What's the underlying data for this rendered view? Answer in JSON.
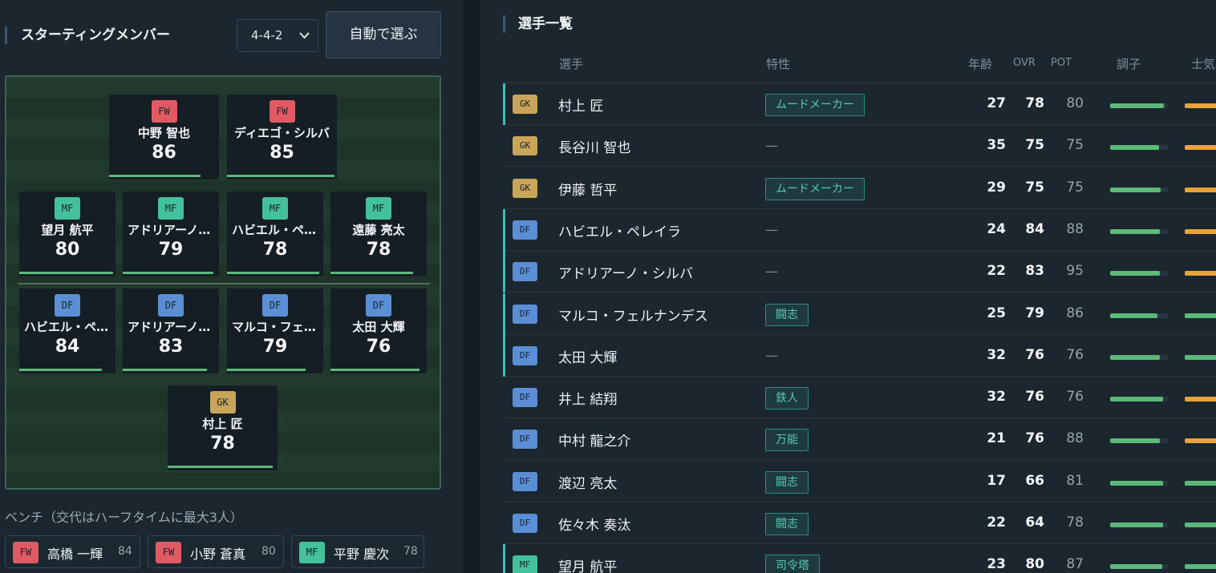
{
  "starting": {
    "title": "スターティングメンバー",
    "formation": "4-4-2",
    "auto_button": "自動で選ぶ"
  },
  "pitch_players": [
    {
      "pos": "FW",
      "name": "中野 智也",
      "ovr": "86",
      "condition": 0.85
    },
    {
      "pos": "FW",
      "name": "ディエゴ・シルバ",
      "ovr": "85",
      "condition": 1.0
    },
    {
      "pos": "MF",
      "name": "望月 航平",
      "ovr": "80",
      "condition": 1.0
    },
    {
      "pos": "MF",
      "name": "アドリアーノ・シルバ",
      "ovr": "79",
      "condition": 0.97
    },
    {
      "pos": "MF",
      "name": "ハビエル・ペレイラ",
      "ovr": "78",
      "condition": 0.98
    },
    {
      "pos": "MF",
      "name": "遠藤 亮太",
      "ovr": "78",
      "condition": 0.88
    },
    {
      "pos": "DF",
      "name": "ハビエル・ペレイラ",
      "ovr": "84",
      "condition": 0.88
    },
    {
      "pos": "DF",
      "name": "アドリアーノ・シルバ",
      "ovr": "83",
      "condition": 0.9
    },
    {
      "pos": "DF",
      "name": "マルコ・フェルナンデス",
      "ovr": "79",
      "condition": 0.84
    },
    {
      "pos": "DF",
      "name": "太田 大輝",
      "ovr": "76",
      "condition": 0.95
    },
    {
      "pos": "GK",
      "name": "村上 匠",
      "ovr": "78",
      "condition": 0.98
    }
  ],
  "bench": {
    "title": "ベンチ（交代はハーフタイムに最大3人）",
    "players": [
      {
        "pos": "FW",
        "name": "高橋 一輝",
        "ovr": "84"
      },
      {
        "pos": "FW",
        "name": "小野 蒼真",
        "ovr": "80"
      },
      {
        "pos": "MF",
        "name": "平野 慶次",
        "ovr": "78"
      }
    ]
  },
  "roster": {
    "title": "選手一覧",
    "headers": {
      "player": "選手",
      "trait": "特性",
      "age": "年齢",
      "ovr": "OVR",
      "pot": "POT",
      "condition": "調子",
      "morale": "士気"
    },
    "rows": [
      {
        "pos": "GK",
        "name": "村上 匠",
        "trait": "ムードメーカー",
        "age": "27",
        "ovr": "78",
        "pot": "80",
        "starter": true,
        "condition": 0.93,
        "morale": 0.64,
        "morale_color": "#e8a33a"
      },
      {
        "pos": "GK",
        "name": "長谷川 智也",
        "trait": "—",
        "age": "35",
        "ovr": "75",
        "pot": "75",
        "starter": false,
        "condition": 0.85,
        "morale": 0.63,
        "morale_color": "#e8a33a"
      },
      {
        "pos": "GK",
        "name": "伊藤 哲平",
        "trait": "ムードメーカー",
        "age": "29",
        "ovr": "75",
        "pot": "75",
        "starter": false,
        "condition": 0.87,
        "morale": 0.77,
        "morale_color": "#e8a33a"
      },
      {
        "pos": "DF",
        "name": "ハビエル・ペレイラ",
        "trait": "—",
        "age": "24",
        "ovr": "84",
        "pot": "88",
        "starter": true,
        "condition": 0.86,
        "morale": 0.64,
        "morale_color": "#e8a33a"
      },
      {
        "pos": "DF",
        "name": "アドリアーノ・シルバ",
        "trait": "—",
        "age": "22",
        "ovr": "83",
        "pot": "95",
        "starter": true,
        "condition": 0.86,
        "morale": 0.76,
        "morale_color": "#e8a33a"
      },
      {
        "pos": "DF",
        "name": "マルコ・フェルナンデス",
        "trait": "闘志",
        "age": "25",
        "ovr": "79",
        "pot": "86",
        "starter": true,
        "condition": 0.82,
        "morale": 0.84,
        "morale_color": "#5cb977"
      },
      {
        "pos": "DF",
        "name": "太田 大輝",
        "trait": "—",
        "age": "32",
        "ovr": "76",
        "pot": "76",
        "starter": true,
        "condition": 0.86,
        "morale": 0.85,
        "morale_color": "#5cb977"
      },
      {
        "pos": "DF",
        "name": "井上 結翔",
        "trait": "鉄人",
        "age": "32",
        "ovr": "76",
        "pot": "76",
        "starter": false,
        "condition": 0.92,
        "morale": 0.6,
        "morale_color": "#e8a33a"
      },
      {
        "pos": "DF",
        "name": "中村 龍之介",
        "trait": "万能",
        "age": "21",
        "ovr": "76",
        "pot": "88",
        "starter": false,
        "condition": 0.86,
        "morale": 0.68,
        "morale_color": "#e8a33a"
      },
      {
        "pos": "DF",
        "name": "渡辺 亮太",
        "trait": "闘志",
        "age": "17",
        "ovr": "66",
        "pot": "81",
        "starter": false,
        "condition": 0.92,
        "morale": 0.8,
        "morale_color": "#5cb977"
      },
      {
        "pos": "DF",
        "name": "佐々木 奏汰",
        "trait": "闘志",
        "age": "22",
        "ovr": "64",
        "pot": "78",
        "starter": false,
        "condition": 0.92,
        "morale": 0.82,
        "morale_color": "#5cb977"
      },
      {
        "pos": "MF",
        "name": "望月 航平",
        "trait": "司令塔",
        "age": "23",
        "ovr": "80",
        "pot": "87",
        "starter": true,
        "condition": 0.9,
        "morale": 0.8,
        "morale_color": "#5cb977"
      }
    ]
  }
}
